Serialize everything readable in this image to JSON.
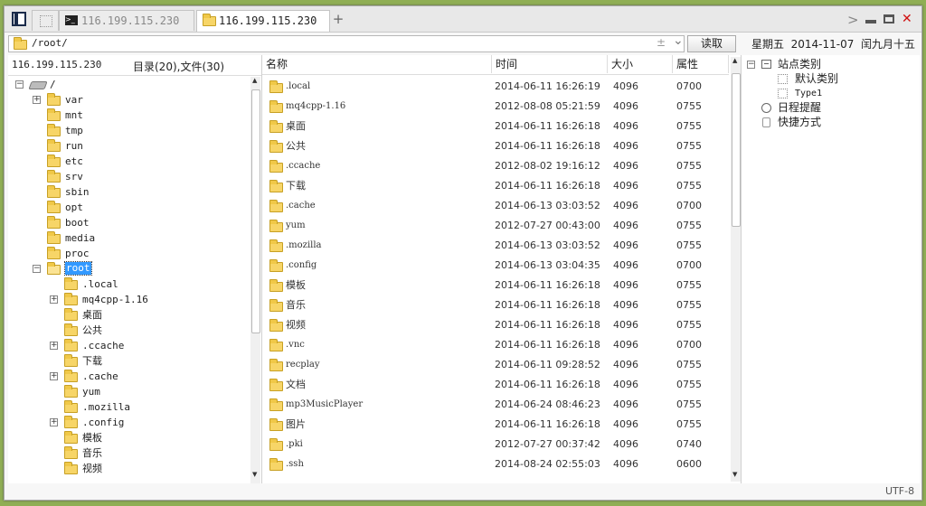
{
  "tabs": [
    {
      "label": "116.199.115.230",
      "active": false
    },
    {
      "label": "116.199.115.230",
      "active": true
    }
  ],
  "add_tab_label": "+",
  "window_controls": {
    "forward": ">",
    "minimize": "–",
    "close": "✕"
  },
  "address": {
    "path": "/root/",
    "pm_glyph": "±",
    "dropdown_glyph": "⌄"
  },
  "read_button_label": "读取",
  "date_display": "星期五  2014-11-07  闰九月十五",
  "left_header": {
    "host": "116.199.115.230",
    "counts": "目录(20),文件(30)"
  },
  "tree": {
    "root_label": "/",
    "items": [
      {
        "label": "var",
        "level": 1,
        "expander": "+"
      },
      {
        "label": "mnt",
        "level": 1,
        "expander": ""
      },
      {
        "label": "tmp",
        "level": 1,
        "expander": ""
      },
      {
        "label": "run",
        "level": 1,
        "expander": ""
      },
      {
        "label": "etc",
        "level": 1,
        "expander": ""
      },
      {
        "label": "srv",
        "level": 1,
        "expander": ""
      },
      {
        "label": "sbin",
        "level": 1,
        "expander": ""
      },
      {
        "label": "opt",
        "level": 1,
        "expander": ""
      },
      {
        "label": "boot",
        "level": 1,
        "expander": ""
      },
      {
        "label": "media",
        "level": 1,
        "expander": ""
      },
      {
        "label": "proc",
        "level": 1,
        "expander": ""
      },
      {
        "label": "root",
        "level": 1,
        "expander": "−",
        "selected": true,
        "open": true
      },
      {
        "label": ".local",
        "level": 2,
        "expander": ""
      },
      {
        "label": "mq4cpp-1.16",
        "level": 2,
        "expander": "+"
      },
      {
        "label": "桌面",
        "level": 2,
        "expander": ""
      },
      {
        "label": "公共",
        "level": 2,
        "expander": ""
      },
      {
        "label": ".ccache",
        "level": 2,
        "expander": "+"
      },
      {
        "label": "下载",
        "level": 2,
        "expander": ""
      },
      {
        "label": ".cache",
        "level": 2,
        "expander": "+"
      },
      {
        "label": "yum",
        "level": 2,
        "expander": ""
      },
      {
        "label": ".mozilla",
        "level": 2,
        "expander": ""
      },
      {
        "label": ".config",
        "level": 2,
        "expander": "+"
      },
      {
        "label": "模板",
        "level": 2,
        "expander": ""
      },
      {
        "label": "音乐",
        "level": 2,
        "expander": ""
      },
      {
        "label": "视频",
        "level": 2,
        "expander": ""
      }
    ]
  },
  "file_list": {
    "columns": [
      "名称",
      "时间",
      "大小",
      "属性"
    ],
    "rows": [
      {
        "name": ".local",
        "time": "2014-06-11 16:26:19",
        "size": "4096",
        "attr": "0700"
      },
      {
        "name": "mq4cpp-1.16",
        "time": "2012-08-08 05:21:59",
        "size": "4096",
        "attr": "0755"
      },
      {
        "name": "桌面",
        "time": "2014-06-11 16:26:18",
        "size": "4096",
        "attr": "0755"
      },
      {
        "name": "公共",
        "time": "2014-06-11 16:26:18",
        "size": "4096",
        "attr": "0755"
      },
      {
        "name": ".ccache",
        "time": "2012-08-02 19:16:12",
        "size": "4096",
        "attr": "0755"
      },
      {
        "name": "下载",
        "time": "2014-06-11 16:26:18",
        "size": "4096",
        "attr": "0755"
      },
      {
        "name": ".cache",
        "time": "2014-06-13 03:03:52",
        "size": "4096",
        "attr": "0700"
      },
      {
        "name": "yum",
        "time": "2012-07-27 00:43:00",
        "size": "4096",
        "attr": "0755"
      },
      {
        "name": ".mozilla",
        "time": "2014-06-13 03:03:52",
        "size": "4096",
        "attr": "0755"
      },
      {
        "name": ".config",
        "time": "2014-06-13 03:04:35",
        "size": "4096",
        "attr": "0700"
      },
      {
        "name": "模板",
        "time": "2014-06-11 16:26:18",
        "size": "4096",
        "attr": "0755"
      },
      {
        "name": "音乐",
        "time": "2014-06-11 16:26:18",
        "size": "4096",
        "attr": "0755"
      },
      {
        "name": "视频",
        "time": "2014-06-11 16:26:18",
        "size": "4096",
        "attr": "0755"
      },
      {
        "name": ".vnc",
        "time": "2014-06-11 16:26:18",
        "size": "4096",
        "attr": "0700"
      },
      {
        "name": "recplay",
        "time": "2014-06-11 09:28:52",
        "size": "4096",
        "attr": "0755"
      },
      {
        "name": "文档",
        "time": "2014-06-11 16:26:18",
        "size": "4096",
        "attr": "0755"
      },
      {
        "name": "mp3MusicPlayer",
        "time": "2014-06-24 08:46:23",
        "size": "4096",
        "attr": "0755"
      },
      {
        "name": "图片",
        "time": "2014-06-11 16:26:18",
        "size": "4096",
        "attr": "0755"
      },
      {
        "name": ".pki",
        "time": "2012-07-27 00:37:42",
        "size": "4096",
        "attr": "0740"
      },
      {
        "name": ".ssh",
        "time": "2014-08-24 02:55:03",
        "size": "4096",
        "attr": "0600"
      }
    ]
  },
  "sites": {
    "root_label": "站点类别",
    "children": [
      "默认类别",
      "Type1"
    ],
    "others": [
      "日程提醒",
      "快捷方式"
    ]
  },
  "status": {
    "encoding": "UTF-8"
  },
  "colors": {
    "selected_bg": "#3399ff",
    "folder": "#f7d567",
    "close_red": "#d01010"
  }
}
